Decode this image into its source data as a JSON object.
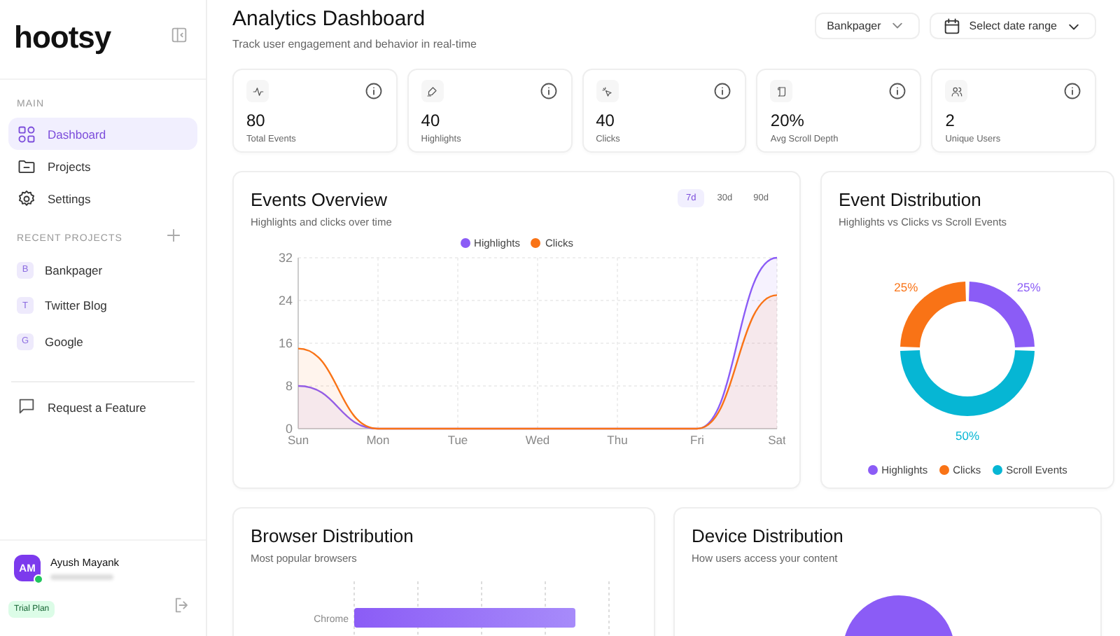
{
  "sidebar": {
    "logo": "hootsy",
    "main_heading": "MAIN",
    "nav": [
      {
        "kind": "grid",
        "label": "Dashboard",
        "selected": true
      },
      {
        "kind": "folder",
        "label": "Projects",
        "selected": false
      },
      {
        "kind": "gear",
        "label": "Settings",
        "selected": false
      }
    ],
    "recent_heading": "RECENT PROJECTS",
    "projects": [
      {
        "initial": "B",
        "label": "Bankpager"
      },
      {
        "initial": "T",
        "label": "Twitter Blog"
      },
      {
        "initial": "G",
        "label": "Google"
      }
    ],
    "feature_link": "Request a Feature",
    "user": {
      "initials": "AM",
      "name": "Ayush Mayank",
      "online": true
    },
    "plan_badge": "Trial Plan"
  },
  "header": {
    "title": "Analytics Dashboard",
    "subtitle": "Track user engagement and behavior in real-time",
    "project_select": "Bankpager",
    "date_select": "Select date range"
  },
  "stats": [
    {
      "kind": "pulse",
      "value": "80",
      "label": "Total Events"
    },
    {
      "kind": "pen",
      "value": "40",
      "label": "Highlights"
    },
    {
      "kind": "sparkle",
      "value": "40",
      "label": "Clicks"
    },
    {
      "kind": "scroll",
      "value": "20%",
      "label": "Avg Scroll Depth"
    },
    {
      "kind": "users",
      "value": "2",
      "label": "Unique Users"
    }
  ],
  "events_overview": {
    "title": "Events Overview",
    "subtitle": "Highlights and clicks over time",
    "ranges": [
      {
        "label": "7d",
        "selected": true
      },
      {
        "label": "30d",
        "selected": false
      },
      {
        "label": "90d",
        "selected": false
      }
    ],
    "chart_data": {
      "type": "area",
      "stacked": false,
      "grid": true,
      "categories": [
        "Sun",
        "Mon",
        "Tue",
        "Wed",
        "Thu",
        "Fri",
        "Sat"
      ],
      "series": [
        {
          "name": "Highlights",
          "color": "#8b5cf6",
          "values": [
            8,
            0,
            0,
            0,
            0,
            0,
            32
          ]
        },
        {
          "name": "Clicks",
          "color": "#f97316",
          "values": [
            15,
            0,
            0,
            0,
            0,
            0,
            25
          ]
        }
      ],
      "ylim": [
        0,
        32
      ],
      "yticks": [
        0,
        8,
        16,
        24,
        32
      ]
    }
  },
  "event_distribution": {
    "title": "Event Distribution",
    "subtitle": "Highlights vs Clicks vs Scroll Events",
    "chart_data": {
      "type": "donut",
      "categories": [
        "Highlights",
        "Clicks",
        "Scroll Events"
      ],
      "values": [
        25,
        25,
        50
      ],
      "colors": [
        "#8b5cf6",
        "#f97316",
        "#06b6d4"
      ],
      "value_labels": [
        "25%",
        "25%",
        "50%"
      ]
    }
  },
  "browser_distribution": {
    "title": "Browser Distribution",
    "subtitle": "Most popular browsers",
    "bar_label": "Chrome"
  },
  "device_distribution": {
    "title": "Device Distribution",
    "subtitle": "How users access your content"
  }
}
